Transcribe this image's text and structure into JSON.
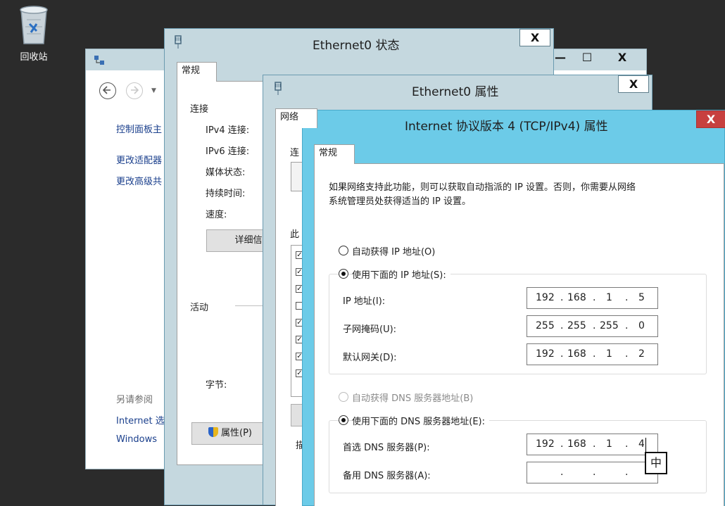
{
  "desktop": {
    "recycle_bin_label": "回收站"
  },
  "control_panel": {
    "nav_home": "控制面板主",
    "link_adapter": "更改适配器",
    "link_advanced": "更改高级共",
    "see_also": "另请参阅",
    "link_internet": "Internet 选",
    "link_windows": "Windows"
  },
  "status_dialog": {
    "title": "Ethernet0 状态",
    "close": "X",
    "tab_general": "常规",
    "section_connection": "连接",
    "ipv4": "IPv4 连接:",
    "ipv6": "IPv6 连接:",
    "media": "媒体状态:",
    "duration": "持续时间:",
    "speed": "速度:",
    "details_button": "详细信",
    "section_activity": "活动",
    "bytes": "字节:",
    "properties_button": "属性(P)"
  },
  "props_dialog": {
    "title": "Ethernet0 属性",
    "close": "X",
    "tab_network": "网络",
    "connect_using": "连",
    "items_label": "此",
    "checkbox_states": [
      true,
      true,
      true,
      false,
      true,
      true,
      true,
      true
    ],
    "partial_label": "描"
  },
  "back_window_buttons": {
    "minimize": "—",
    "maximize": "☐",
    "close": "X"
  },
  "ipv4_dialog": {
    "title": "Internet 协议版本 4 (TCP/IPv4) 属性",
    "close": "X",
    "tab_general": "常规",
    "intro_line1": "如果网络支持此功能，则可以获取自动指派的 IP 设置。否则，你需要从网络",
    "intro_line2": "系统管理员处获得适当的 IP 设置。",
    "radio_auto_ip": "自动获得 IP 地址(O)",
    "radio_manual_ip": "使用下面的 IP 地址(S):",
    "ip_label": "IP 地址(I):",
    "ip_value": [
      "192",
      "168",
      "1",
      "5"
    ],
    "mask_label": "子网掩码(U):",
    "mask_value": [
      "255",
      "255",
      "255",
      "0"
    ],
    "gateway_label": "默认网关(D):",
    "gateway_value": [
      "192",
      "168",
      "1",
      "2"
    ],
    "radio_auto_dns": "自动获得 DNS 服务器地址(B)",
    "radio_manual_dns": "使用下面的 DNS 服务器地址(E):",
    "dns1_label": "首选 DNS 服务器(P):",
    "dns1_value": [
      "192",
      "168",
      "1",
      "4"
    ],
    "dns2_label": "备用 DNS 服务器(A):",
    "dns2_value": [
      "",
      "",
      "",
      ""
    ],
    "dot": ".",
    "ime_indicator": "中"
  },
  "colors": {
    "desktop": "#2b2b2b",
    "active_titlebar": "#6ccbe8",
    "inactive_titlebar": "#c5d8df",
    "close_red": "#c7403f"
  }
}
